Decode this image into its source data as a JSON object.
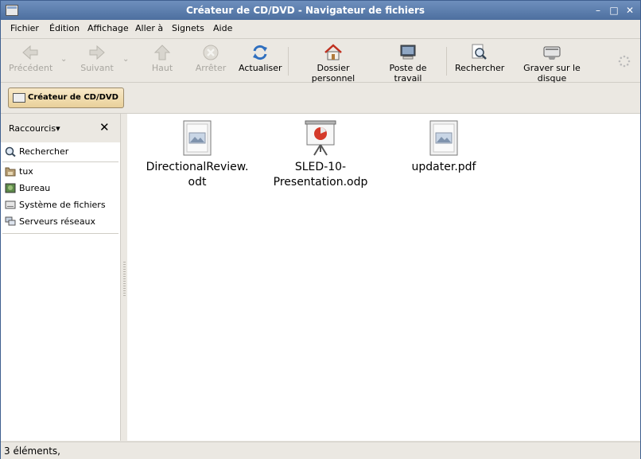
{
  "window": {
    "title": "Créateur de CD/DVD - Navigateur de fichiers",
    "minimize": "–",
    "maximize": "□",
    "close": "✕"
  },
  "menu": {
    "items": [
      {
        "label": "Fichier"
      },
      {
        "label": "Édition"
      },
      {
        "label": "Affichage"
      },
      {
        "label": "Aller à"
      },
      {
        "label": "Signets"
      },
      {
        "label": "Aide"
      }
    ]
  },
  "toolbar": {
    "back": "Précédent",
    "forward": "Suivant",
    "up": "Haut",
    "stop": "Arrêter",
    "reload": "Actualiser",
    "home": "Dossier personnel",
    "computer": "Poste de travail",
    "search": "Rechercher",
    "burn": "Graver sur le disque",
    "chevron": "⌄"
  },
  "location": {
    "button_label": "Créateur de CD/DVD"
  },
  "sidebar": {
    "selector_label": "Raccourcis",
    "selector_arrow": "▾",
    "close": "✕",
    "search_item": "Rechercher",
    "items": [
      {
        "label": "tux",
        "icon": "home-folder-icon"
      },
      {
        "label": "Bureau",
        "icon": "desktop-icon"
      },
      {
        "label": "Système de fichiers",
        "icon": "drive-icon"
      },
      {
        "label": "Serveurs réseaux",
        "icon": "network-icon"
      }
    ]
  },
  "files": [
    {
      "name_line1": "DirectionalReview.",
      "name_line2": "odt",
      "icon": "document-icon"
    },
    {
      "name_line1": "SLED-10-",
      "name_line2": "Presentation.odp",
      "icon": "presentation-icon"
    },
    {
      "name_line1": "updater.pdf",
      "name_line2": "",
      "icon": "document-icon"
    }
  ],
  "status": {
    "text": "3 éléments,"
  },
  "colors": {
    "titlebar": "#5a7bab",
    "panel": "#ebe8e2",
    "location_button": "#efdcae"
  }
}
